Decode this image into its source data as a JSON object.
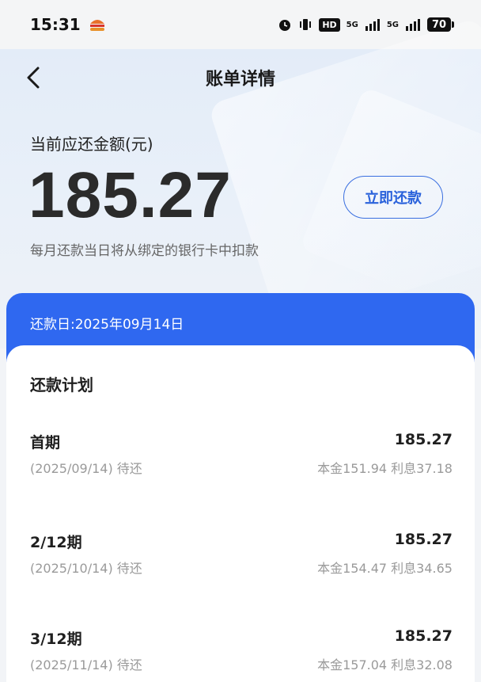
{
  "status_bar": {
    "time": "15:31",
    "hd": "HD",
    "net1": "5G",
    "net2": "5G",
    "battery": "70"
  },
  "nav": {
    "title": "账单详情"
  },
  "summary": {
    "amount_label": "当前应还金额(元)",
    "amount": "185.27",
    "repay_button": "立即还款",
    "note": "每月还款当日将从绑定的银行卡中扣款"
  },
  "due": {
    "text": "还款日:2025年09月14日"
  },
  "plan": {
    "title": "还款计划",
    "rows": [
      {
        "name": "首期",
        "amount": "185.27",
        "status": "(2025/09/14) 待还",
        "detail": "本金151.94 利息37.18"
      },
      {
        "name": "2/12期",
        "amount": "185.27",
        "status": "(2025/10/14) 待还",
        "detail": "本金154.47 利息34.65"
      },
      {
        "name": "3/12期",
        "amount": "185.27",
        "status": "(2025/11/14) 待还",
        "detail": "本金157.04 利息32.08"
      }
    ]
  },
  "colors": {
    "accent": "#2f68f0",
    "button_text": "#2a62db"
  }
}
